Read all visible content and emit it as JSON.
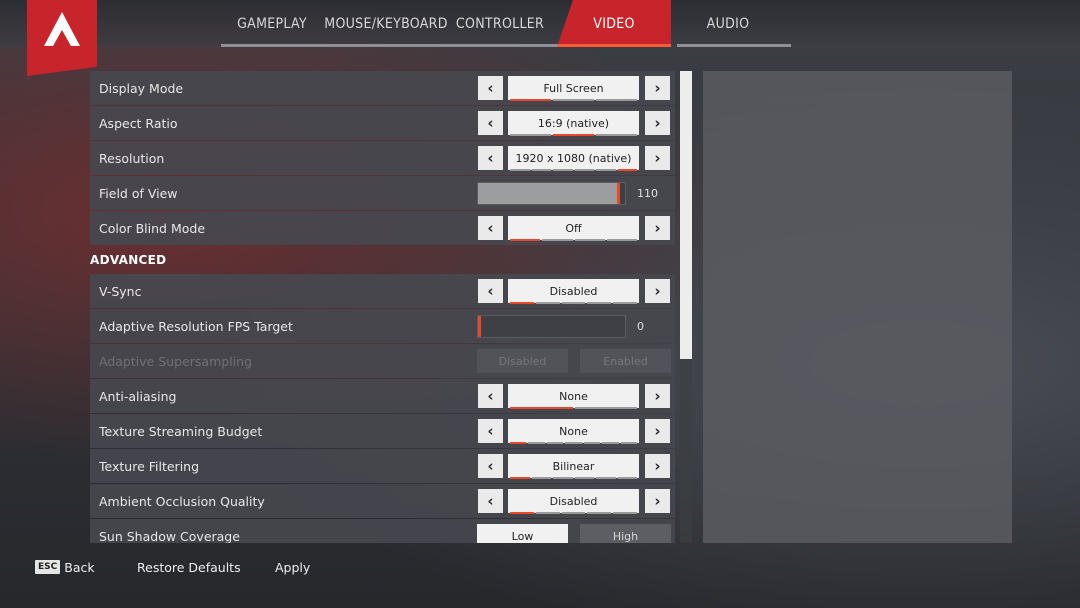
{
  "tabs": [
    {
      "label": "GAMEPLAY",
      "active": false
    },
    {
      "label": "MOUSE/KEYBOARD",
      "active": false
    },
    {
      "label": "CONTROLLER",
      "active": false
    },
    {
      "label": "VIDEO",
      "active": true
    },
    {
      "label": "AUDIO",
      "active": false
    }
  ],
  "settings": {
    "display_mode": {
      "label": "Display Mode",
      "value": "Full Screen",
      "segments": 3,
      "selected": 0
    },
    "aspect_ratio": {
      "label": "Aspect Ratio",
      "value": "16:9 (native)",
      "segments": 3,
      "selected": 1
    },
    "resolution": {
      "label": "Resolution",
      "value": "1920 x 1080 (native)",
      "segments": 6,
      "selected": 5
    },
    "field_of_view": {
      "label": "Field of View",
      "value": "110",
      "fraction": 0.98
    },
    "color_blind": {
      "label": "Color Blind Mode",
      "value": "Off",
      "segments": 4,
      "selected": 0
    }
  },
  "advanced": {
    "title": "ADVANCED",
    "vsync": {
      "label": "V-Sync",
      "value": "Disabled",
      "segments": 5,
      "selected": 0
    },
    "adaptive_fps": {
      "label": "Adaptive Resolution FPS Target",
      "value": "0",
      "fraction": 0.0
    },
    "adaptive_supersampling": {
      "label": "Adaptive Supersampling",
      "option_a": "Disabled",
      "option_b": "Enabled"
    },
    "anti_aliasing": {
      "label": "Anti-aliasing",
      "value": "None",
      "segments": 2,
      "selected": 0
    },
    "texture_budget": {
      "label": "Texture Streaming Budget",
      "value": "None",
      "segments": 7,
      "selected": 0
    },
    "texture_filtering": {
      "label": "Texture Filtering",
      "value": "Bilinear",
      "segments": 6,
      "selected": 0
    },
    "ambient_occlusion": {
      "label": "Ambient Occlusion Quality",
      "value": "Disabled",
      "segments": 5,
      "selected": 0
    },
    "sun_shadow": {
      "label": "Sun Shadow Coverage",
      "option_a": "Low",
      "option_b": "High"
    }
  },
  "scroll": {
    "fraction": 0.61
  },
  "footer": {
    "esc_key": "ESC",
    "back": "Back",
    "restore": "Restore Defaults",
    "apply": "Apply"
  },
  "colors": {
    "accent": "#c8242b",
    "highlight": "#e8492b"
  }
}
